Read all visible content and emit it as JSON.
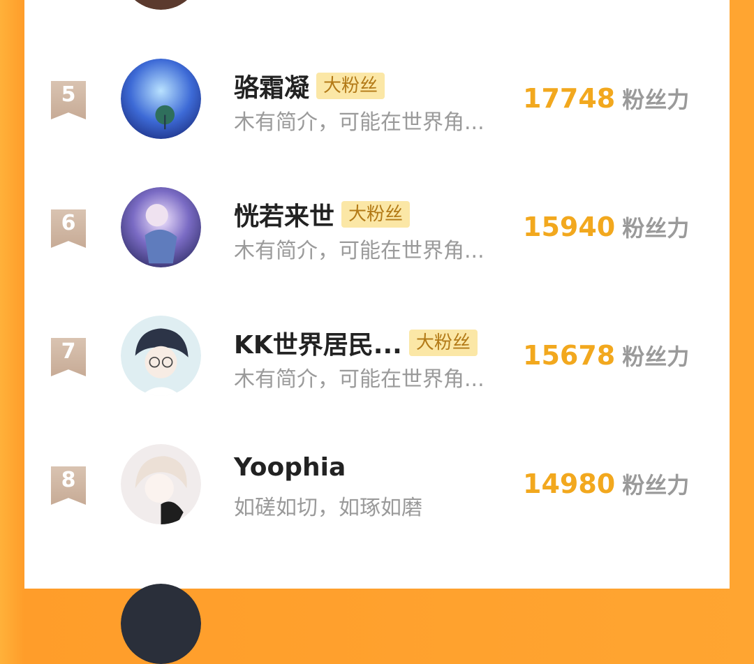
{
  "rows": [
    {
      "rank": "5",
      "name": "骆霜凝",
      "badge": "大粉丝",
      "bio": "木有简介，可能在世界角...",
      "score": "17748",
      "unit": "粉丝力"
    },
    {
      "rank": "6",
      "name": "恍若来世",
      "badge": "大粉丝",
      "bio": "木有简介，可能在世界角...",
      "score": "15940",
      "unit": "粉丝力"
    },
    {
      "rank": "7",
      "name": "KK世界居民...",
      "badge": "大粉丝",
      "bio": "木有简介，可能在世界角...",
      "score": "15678",
      "unit": "粉丝力"
    },
    {
      "rank": "8",
      "name": "Yoophia",
      "badge": "",
      "bio": "如磋如切，如琢如磨",
      "score": "14980",
      "unit": "粉丝力"
    }
  ]
}
